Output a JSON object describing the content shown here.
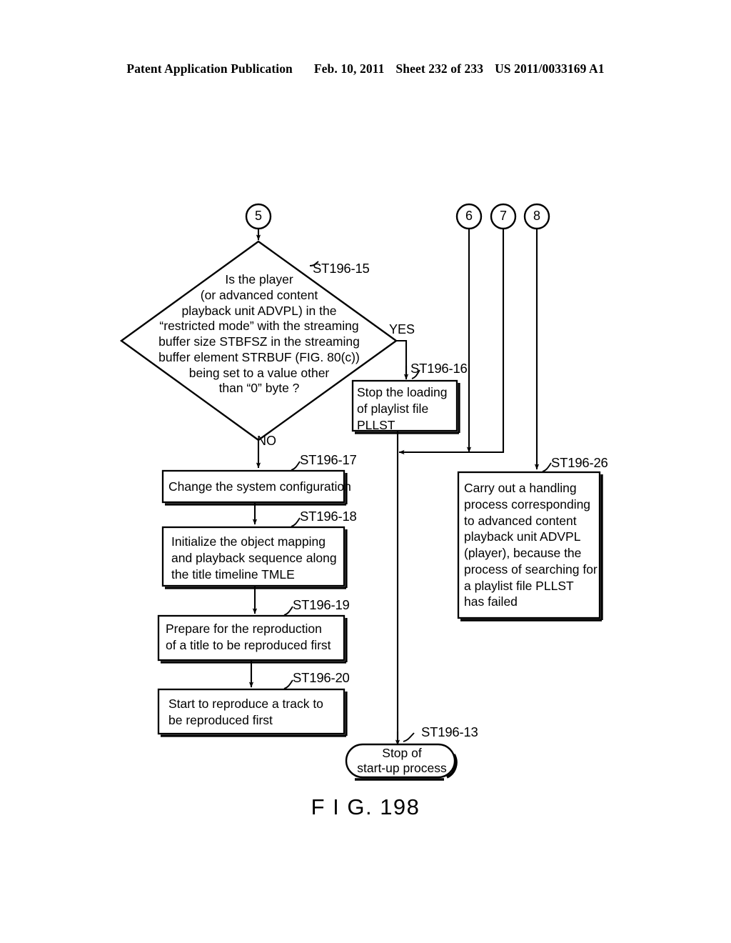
{
  "header": {
    "publication": "Patent Application Publication",
    "date": "Feb. 10, 2011",
    "sheet": "Sheet 232 of 233",
    "docnum": "US 2011/0033169 A1"
  },
  "figure": {
    "caption": "F I G. 198"
  },
  "connectors": [
    {
      "id": "conn-5",
      "label": "5"
    },
    {
      "id": "conn-6",
      "label": "6"
    },
    {
      "id": "conn-7",
      "label": "7"
    },
    {
      "id": "conn-8",
      "label": "8"
    }
  ],
  "branches": {
    "yes": "YES",
    "no": "NO"
  },
  "steps": {
    "st196_15": "ST196-15",
    "st196_16": "ST196-16",
    "st196_17": "ST196-17",
    "st196_18": "ST196-18",
    "st196_19": "ST196-19",
    "st196_20": "ST196-20",
    "st196_26": "ST196-26",
    "st196_13": "ST196-13"
  },
  "nodes": {
    "decision": "Is the player\n(or advanced content\nplayback unit ADVPL) in the\n“restricted mode” with the streaming\nbuffer size STBFSZ in the streaming\nbuffer element STRBUF (FIG. 80(c))\nbeing set to a value other\nthan “0” byte ?",
    "stop_loading": "Stop the loading\nof playlist file\nPLLST",
    "change_config": "Change the system configuration",
    "initialize": "Initialize the object mapping\nand playback sequence along\nthe title timeline TMLE",
    "prepare": "Prepare for the reproduction\nof a title to be reproduced first",
    "start_track": "Start to reproduce a track to\nbe reproduced first",
    "carry_out": "Carry out a handling\nprocess corresponding\nto advanced content\nplayback unit ADVPL\n(player), because the\nprocess of searching for\na playlist file PLLST\nhas failed",
    "terminal": "Stop of\nstart-up process"
  },
  "colors": {
    "ink": "#000000",
    "paper": "#ffffff"
  },
  "chart_data": {
    "type": "diagram",
    "title": "F I G. 198",
    "nodes": [
      {
        "id": "conn-5",
        "shape": "connector-circle",
        "label": "5"
      },
      {
        "id": "conn-6",
        "shape": "connector-circle",
        "label": "6"
      },
      {
        "id": "conn-7",
        "shape": "connector-circle",
        "label": "7"
      },
      {
        "id": "conn-8",
        "shape": "connector-circle",
        "label": "8"
      },
      {
        "id": "ST196-15",
        "shape": "diamond",
        "label": "Is the player (or advanced content playback unit ADVPL) in the “restricted mode” with the streaming buffer size STBFSZ in the streaming buffer element STRBUF (FIG. 80(c)) being set to a value other than “0” byte ?"
      },
      {
        "id": "ST196-16",
        "shape": "process",
        "label": "Stop the loading of playlist file PLLST"
      },
      {
        "id": "ST196-17",
        "shape": "process",
        "label": "Change the system configuration"
      },
      {
        "id": "ST196-18",
        "shape": "process",
        "label": "Initialize the object mapping and playback sequence along the title timeline TMLE"
      },
      {
        "id": "ST196-19",
        "shape": "process",
        "label": "Prepare for the reproduction of a title to be reproduced first"
      },
      {
        "id": "ST196-20",
        "shape": "process",
        "label": "Start to reproduce a track to be reproduced first"
      },
      {
        "id": "ST196-26",
        "shape": "process",
        "label": "Carry out a handling process corresponding to advanced content playback unit ADVPL (player), because the process of searching for a playlist file PLLST has failed"
      },
      {
        "id": "ST196-13",
        "shape": "terminal",
        "label": "Stop of start-up process"
      }
    ],
    "edges": [
      {
        "from": "conn-5",
        "to": "ST196-15",
        "label": ""
      },
      {
        "from": "ST196-15",
        "to": "ST196-16",
        "label": "YES"
      },
      {
        "from": "ST196-15",
        "to": "ST196-17",
        "label": "NO"
      },
      {
        "from": "ST196-17",
        "to": "ST196-18",
        "label": ""
      },
      {
        "from": "ST196-18",
        "to": "ST196-19",
        "label": ""
      },
      {
        "from": "ST196-19",
        "to": "ST196-20",
        "label": ""
      },
      {
        "from": "ST196-16",
        "to": "ST196-13",
        "label": ""
      },
      {
        "from": "conn-6",
        "to": "ST196-13",
        "label": ""
      },
      {
        "from": "conn-7",
        "to": "ST196-13",
        "label": ""
      },
      {
        "from": "conn-8",
        "to": "ST196-26",
        "label": ""
      }
    ]
  }
}
